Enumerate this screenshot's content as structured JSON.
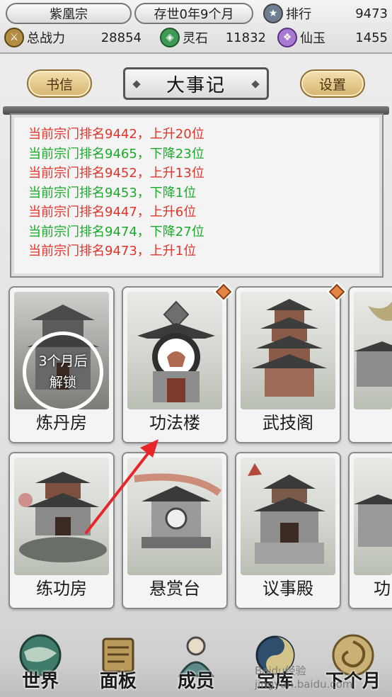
{
  "topbar": {
    "sect_name": "紫凰宗",
    "time_label": "存世0年9个月",
    "rank_label": "排行",
    "rank_value": "9473",
    "power_label": "总战力",
    "power_value": "28854",
    "spirit_stone_label": "灵石",
    "spirit_stone_value": "11832",
    "jade_label": "仙玉",
    "jade_value": "1455"
  },
  "header": {
    "letters_label": "书信",
    "title": "大事记",
    "settings_label": "设置"
  },
  "log": [
    {
      "text": "当前宗门排名9442，上升20位",
      "color": "#e2342b"
    },
    {
      "text": "当前宗门排名9465，下降23位",
      "color": "#1aaa2a"
    },
    {
      "text": "当前宗门排名9452，上升13位",
      "color": "#e2342b"
    },
    {
      "text": "当前宗门排名9453，下降1位",
      "color": "#1aaa2a"
    },
    {
      "text": "当前宗门排名9447，上升6位",
      "color": "#e2342b"
    },
    {
      "text": "当前宗门排名9474，下降27位",
      "color": "#1aaa2a"
    },
    {
      "text": "当前宗门排名9473，上升1位",
      "color": "#e2342b"
    }
  ],
  "buildings": {
    "alchemy_room": {
      "label": "炼丹房",
      "lock_line1": "3个月后",
      "lock_line2": "解锁"
    },
    "technique_tower": {
      "label": "功法楼"
    },
    "martial_pavilion": {
      "label": "武技阁"
    },
    "training_room": {
      "label": "练功房"
    },
    "bounty_stage": {
      "label": "悬赏台"
    },
    "council_hall": {
      "label": "议事殿"
    },
    "partial_right_bottom": {
      "label": "功"
    }
  },
  "nav": {
    "world": "世界",
    "panel": "面板",
    "members": "成员",
    "treasury": "宝库",
    "next_month": "下个月"
  },
  "watermark": "Baidu经验 jingyan.baidu.com",
  "colors": {
    "rise": "#e2342b",
    "fall": "#1aaa2a",
    "gold_button": "#d6b46e",
    "badge": "#e28645",
    "arrow": "#e8262a"
  }
}
